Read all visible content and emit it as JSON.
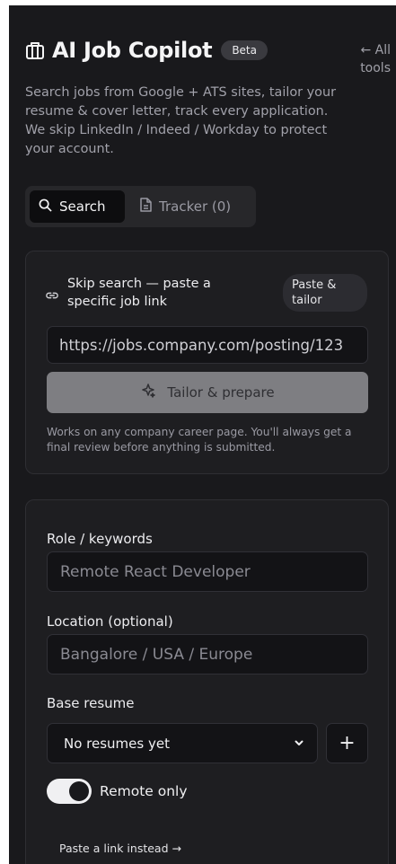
{
  "header": {
    "title": "AI Job Copilot",
    "badge": "Beta",
    "back_link": "← All tools",
    "description": "Search jobs from Google + ATS sites, tailor your resume & cover letter, track every application. We skip LinkedIn / Indeed / Workday to protect your account.",
    "brand_icon": "briefcase-icon"
  },
  "tabs": [
    {
      "label": "Search",
      "icon": "search-icon",
      "active": true
    },
    {
      "label": "Tracker (0)",
      "icon": "document-icon",
      "active": false
    }
  ],
  "quick_link": {
    "title": "Skip search — paste a specific job link",
    "pill": "Paste & tailor",
    "url_value": "https://jobs.company.com/posting/123",
    "button_label": "Tailor & prepare",
    "note": "Works on any company career page. You'll always get a final review before anything is submitted."
  },
  "search_form": {
    "role_label": "Role / keywords",
    "role_placeholder": "Remote React Developer",
    "location_label": "Location (optional)",
    "location_placeholder": "Bangalore / USA / Europe",
    "resume_label": "Base resume",
    "resume_selected": "No resumes yet",
    "add_resume": "+",
    "remote_only_label": "Remote only",
    "remote_only": true,
    "paste_link": "Paste a link instead →"
  }
}
